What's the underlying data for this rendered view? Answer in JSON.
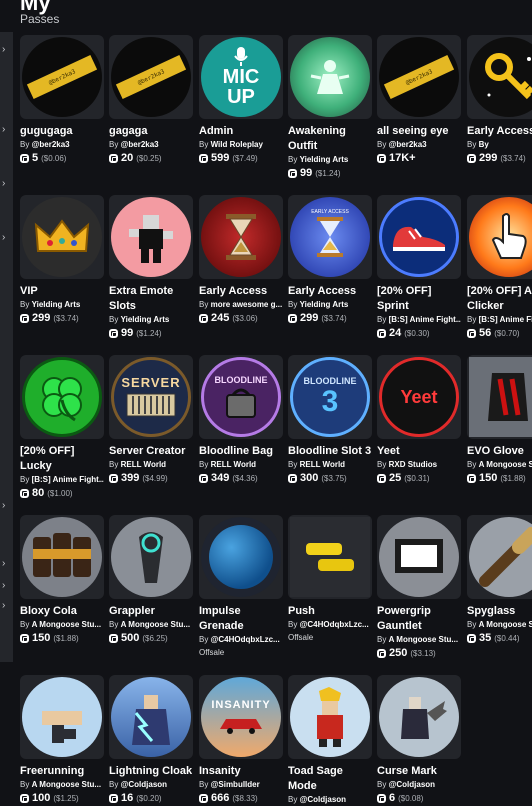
{
  "page": {
    "heading_fragment": "My",
    "section_label": "Passes"
  },
  "passes": [
    {
      "name": "gugugaga",
      "by": "By",
      "creator": "@ber2ka3",
      "price": "5",
      "usd": "($0.06)",
      "art": "ticket"
    },
    {
      "name": "gagaga",
      "by": "By",
      "creator": "@ber2ka3",
      "price": "20",
      "usd": "($0.25)",
      "art": "ticket"
    },
    {
      "name": "Admin",
      "by": "By",
      "creator": "Wild Roleplay",
      "price": "599",
      "usd": "($7.49)",
      "art": "micup"
    },
    {
      "name": "Awakening Outfit",
      "by": "By",
      "creator": "Yielding Arts",
      "price": "99",
      "usd": "($1.24)",
      "art": "awaken"
    },
    {
      "name": "all seeing eye",
      "by": "By",
      "creator": "@ber2ka3",
      "price": "17K+",
      "usd": "",
      "art": "ticket"
    },
    {
      "name": "Early Access",
      "by": "By",
      "creator": "By",
      "price": "299",
      "usd": "($3.74)",
      "art": "key"
    },
    {
      "name": "VIP",
      "by": "By",
      "creator": "Yielding Arts",
      "price": "299",
      "usd": "($3.74)",
      "art": "vip"
    },
    {
      "name": "Extra Emote Slots",
      "by": "By",
      "creator": "Yielding Arts",
      "price": "99",
      "usd": "($1.24)",
      "art": "emote"
    },
    {
      "name": "Early Access",
      "by": "By",
      "creator": "more awesome g...",
      "price": "245",
      "usd": "($3.06)",
      "art": "hourglass-red"
    },
    {
      "name": "Early Access",
      "by": "By",
      "creator": "Yielding Arts",
      "price": "299",
      "usd": "($3.74)",
      "art": "hourglass-blue"
    },
    {
      "name": "[20% OFF] Sprint",
      "by": "By",
      "creator": "[B:S] Anime Fight...",
      "price": "24",
      "usd": "($0.30)",
      "art": "shoe"
    },
    {
      "name": "[20% OFF] Auto Clicker",
      "by": "By",
      "creator": "[B:S] Anime Fig...",
      "price": "56",
      "usd": "($0.70)",
      "art": "clicker"
    },
    {
      "name": "[20% OFF] Lucky",
      "by": "By",
      "creator": "[B:S] Anime Fight...",
      "price": "80",
      "usd": "($1.00)",
      "art": "clover"
    },
    {
      "name": "Server Creator",
      "by": "By",
      "creator": "RELL World",
      "price": "399",
      "usd": "($4.99)",
      "art": "server"
    },
    {
      "name": "Bloodline Bag",
      "by": "By",
      "creator": "RELL World",
      "price": "349",
      "usd": "($4.36)",
      "art": "bloodbag"
    },
    {
      "name": "Bloodline Slot 3",
      "by": "By",
      "creator": "RELL World",
      "price": "300",
      "usd": "($3.75)",
      "art": "bloodslot"
    },
    {
      "name": "Yeet",
      "by": "By",
      "creator": "RXD Studios",
      "price": "25",
      "usd": "($0.31)",
      "art": "yeet"
    },
    {
      "name": "EVO Glove",
      "by": "By",
      "creator": "A Mongoose S...",
      "price": "150",
      "usd": "($1.88)",
      "art": "evoglove"
    },
    {
      "name": "Bloxy Cola",
      "by": "By",
      "creator": "A Mongoose Stu...",
      "price": "150",
      "usd": "($1.88)",
      "art": "cola"
    },
    {
      "name": "Grappler",
      "by": "By",
      "creator": "A Mongoose Stu...",
      "price": "500",
      "usd": "($6.25)",
      "art": "grappler"
    },
    {
      "name": "Impulse Grenade",
      "by": "By",
      "creator": "@C4HOdqbxLzc...",
      "price": "",
      "usd": "",
      "offsale": "Offsale",
      "art": "grenade"
    },
    {
      "name": "Push",
      "by": "By",
      "creator": "@C4HOdqbxLzc...",
      "price": "",
      "usd": "",
      "offsale": "Offsale",
      "art": "push"
    },
    {
      "name": "Powergrip Gauntlet",
      "by": "By",
      "creator": "A Mongoose Stu...",
      "price": "250",
      "usd": "($3.13)",
      "art": "gauntlet"
    },
    {
      "name": "Spyglass",
      "by": "By",
      "creator": "A Mongoose S...",
      "price": "35",
      "usd": "($0.44)",
      "art": "spyglass"
    },
    {
      "name": "Freerunning",
      "by": "By",
      "creator": "A Mongoose Stu...",
      "price": "100",
      "usd": "($1.25)",
      "art": "freerun"
    },
    {
      "name": "Lightning Cloak",
      "by": "By",
      "creator": "@Coldjason",
      "price": "16",
      "usd": "($0.20)",
      "art": "cloak"
    },
    {
      "name": "Insanity",
      "by": "By",
      "creator": "@Simbullder",
      "price": "666",
      "usd": "($8.33)",
      "art": "insanity"
    },
    {
      "name": "Toad Sage Mode",
      "by": "By",
      "creator": "@Coldjason",
      "price": "",
      "usd": "",
      "art": "toad"
    },
    {
      "name": "Curse Mark",
      "by": "By",
      "creator": "@Coldjason",
      "price": "6",
      "usd": "($0.08)",
      "art": "curse"
    }
  ],
  "art_labels": {
    "ticket": "@ber2ka3",
    "micup_top": "MIC",
    "micup_bottom": "UP",
    "early_access": "EARLY ACCESS",
    "server": "SERVER",
    "bloodline": "BLOODLINE",
    "bloodline_num": "3",
    "yeet": "Yeet",
    "insanity": "INSANITY"
  }
}
